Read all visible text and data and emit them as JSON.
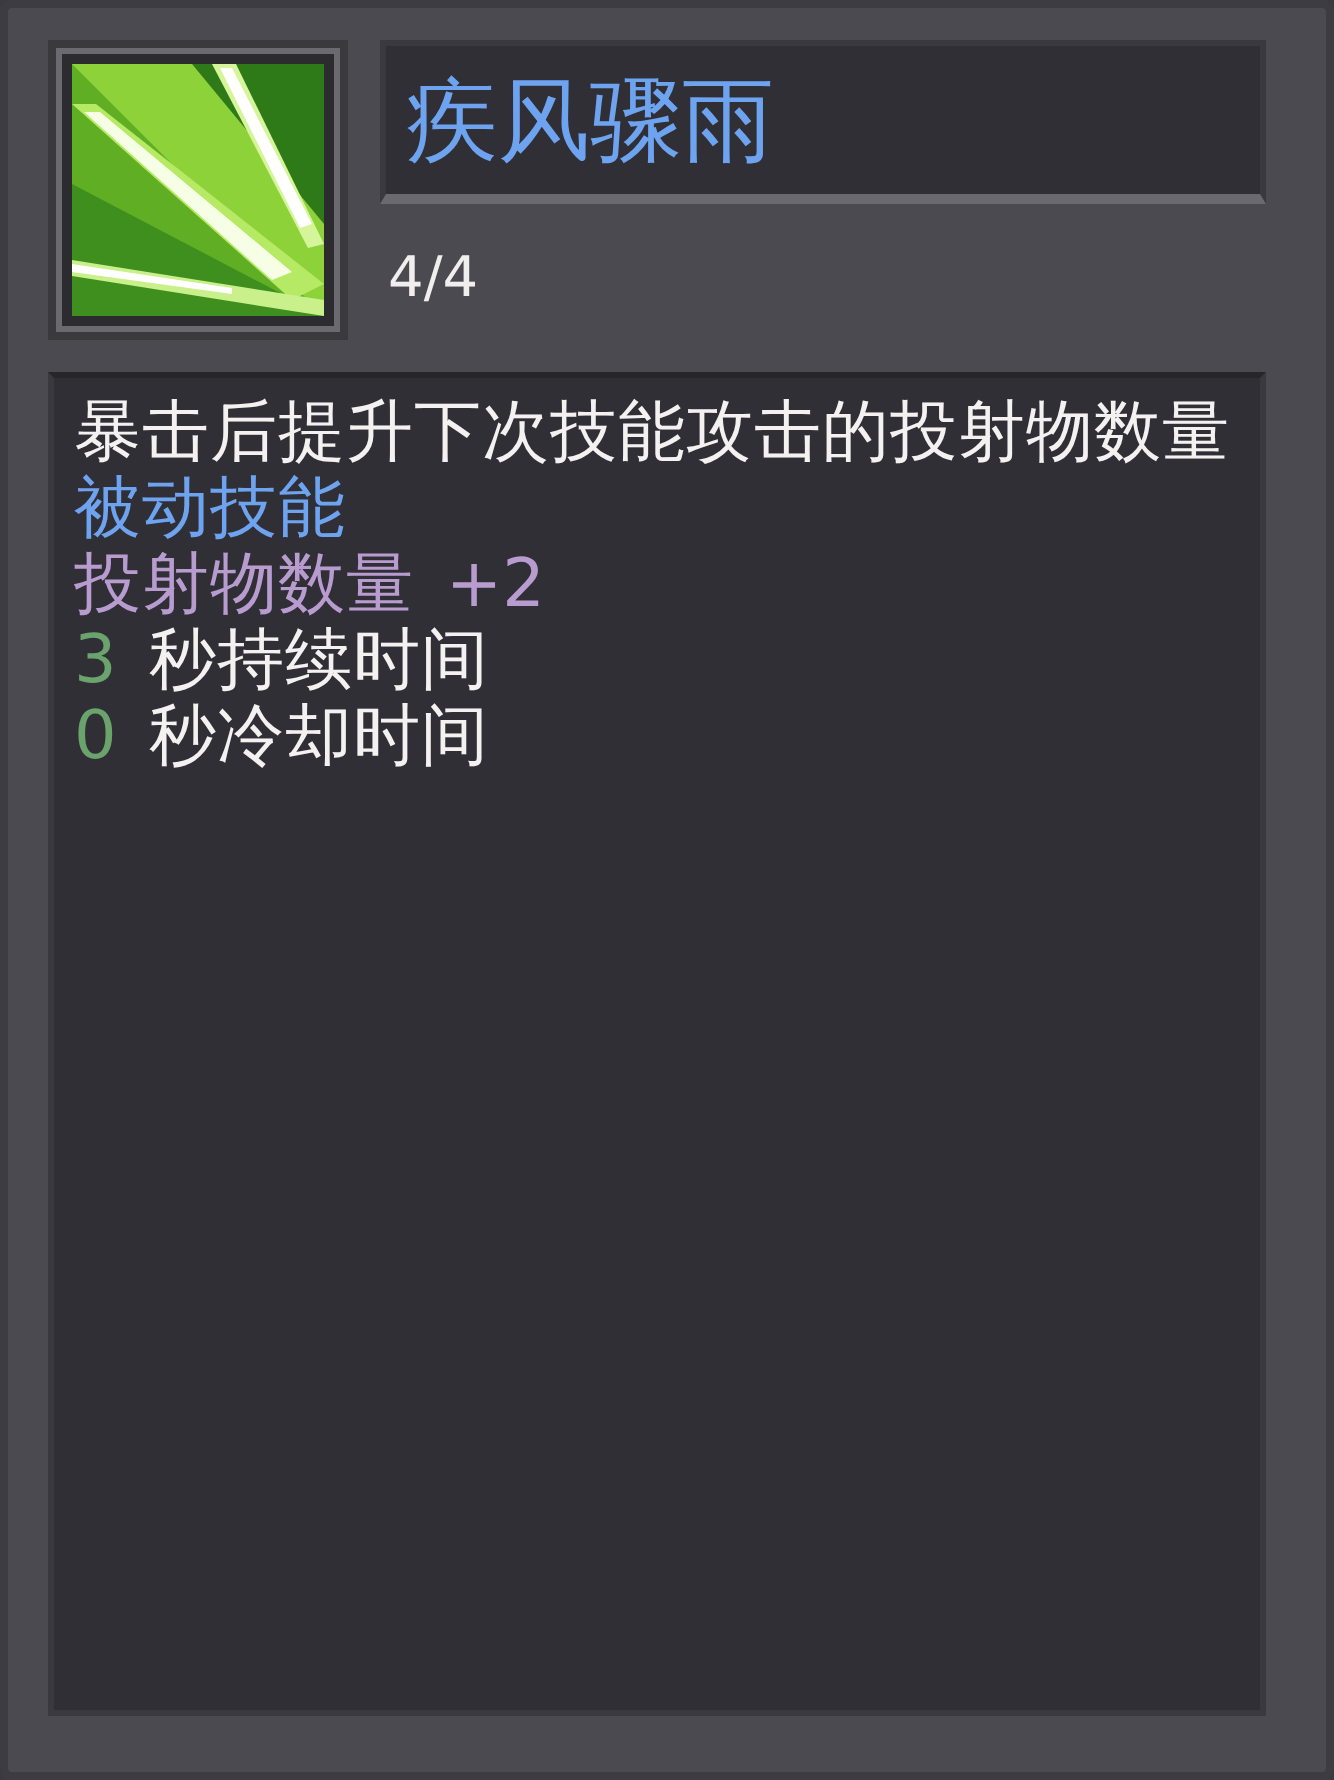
{
  "skill": {
    "name": "疾风骤雨",
    "level": "4/4"
  },
  "lines": [
    {
      "kind": "description",
      "text": "暴击后提升下次技能攻击的投射物数量"
    },
    {
      "kind": "type",
      "text": "被动技能"
    },
    {
      "kind": "stat",
      "text": "投射物数量",
      "value": "+2"
    },
    {
      "kind": "timer",
      "value": "3",
      "text": "秒持续时间"
    },
    {
      "kind": "timer",
      "value": "0",
      "text": "秒冷却时间"
    }
  ]
}
